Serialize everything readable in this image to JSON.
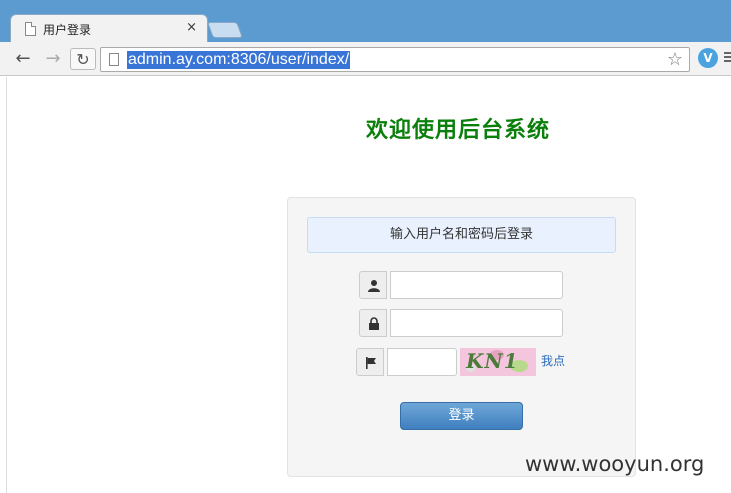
{
  "browser": {
    "tab_title": "用户登录",
    "tab_close": "×",
    "url": "admin.ay.com:8306/user/index/",
    "ext_label": "V",
    "icons": {
      "back": "arrow-left-icon",
      "forward": "arrow-right-icon",
      "reload": "reload-icon",
      "bookmark": "star-icon",
      "extension": "extension-icon",
      "menu": "menu-icon"
    }
  },
  "page": {
    "heading": "欢迎使用后台系统",
    "notice": "输入用户名和密码后登录",
    "username": {
      "value": "",
      "icon": "user-icon"
    },
    "password": {
      "value": "",
      "icon": "lock-icon"
    },
    "captcha": {
      "value": "",
      "icon": "flag-icon",
      "image_text": "KN1",
      "refresh_link": "我点"
    },
    "login_button": "登录",
    "colors": {
      "heading": "#0b7f0b",
      "button": "#4f8cc9",
      "notice_bg": "#e8f1fd"
    }
  },
  "watermark": "www.wooyun.org"
}
